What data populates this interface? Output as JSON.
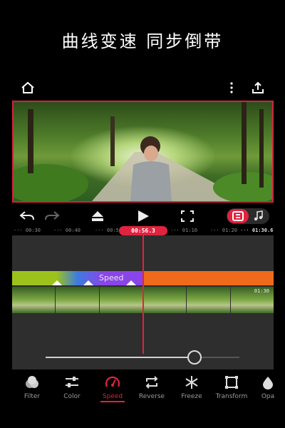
{
  "headline": "曲线变速  同步倒带",
  "colors": {
    "accent": "#e0233f",
    "speed_green": "#9cc31c",
    "speed_purple": "#8a45e8",
    "speed_orange": "#f06a1c"
  },
  "top_bar": {
    "icons": [
      "home-icon",
      "more-vertical-icon",
      "share-icon"
    ]
  },
  "controls": {
    "icons": [
      "undo-icon",
      "redo-icon",
      "keyframe-icon",
      "play-icon",
      "fullscreen-icon",
      "video-track-icon",
      "music-icon"
    ]
  },
  "timeline": {
    "ruler_ticks": [
      "00:30",
      "00:40",
      "00:50",
      "01:10",
      "01:20",
      "01:30.6"
    ],
    "playhead_time": "00:56.3",
    "speed_track_label": "Speed",
    "clip_duration": "01:30"
  },
  "speed_slider": {
    "value": 0.77
  },
  "toolbar": {
    "items": [
      {
        "label": "Filter",
        "icon": "filter-icon"
      },
      {
        "label": "Color",
        "icon": "color-adjust-icon"
      },
      {
        "label": "Speed",
        "icon": "speedometer-icon"
      },
      {
        "label": "Reverse",
        "icon": "reverse-icon"
      },
      {
        "label": "Freeze",
        "icon": "snowflake-icon"
      },
      {
        "label": "Transform",
        "icon": "transform-icon"
      },
      {
        "label": "Opa",
        "icon": "opacity-icon"
      }
    ],
    "selected": "Speed"
  }
}
